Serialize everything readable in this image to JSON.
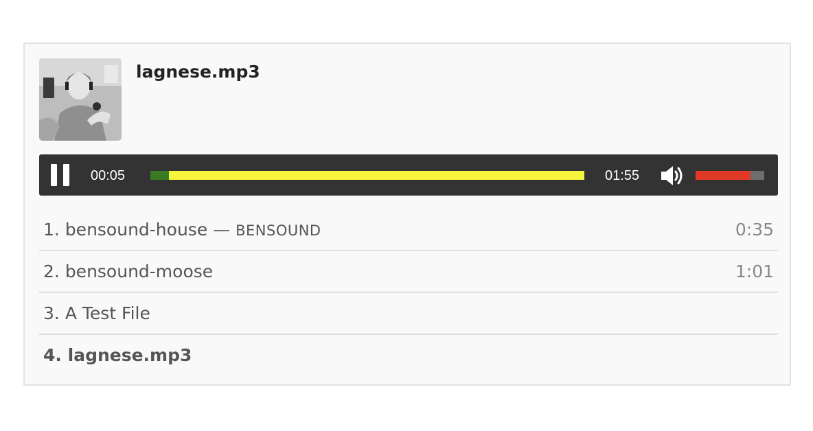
{
  "player": {
    "current_title": "lagnese.mp3",
    "current_time": "00:05",
    "duration": "01:55",
    "progress_fraction": 0.042,
    "volume_fraction": 0.8,
    "play_state": "playing",
    "cover_image": "album-cover-photo"
  },
  "playlist": [
    {
      "number": "1.",
      "title": "bensound-house",
      "separator": " — ",
      "artist": "BENSOUND",
      "length": "0:35",
      "active": false
    },
    {
      "number": "2.",
      "title": "bensound-moose",
      "separator": "",
      "artist": "",
      "length": "1:01",
      "active": false
    },
    {
      "number": "3.",
      "title": "A Test File",
      "separator": "",
      "artist": "",
      "length": "",
      "active": false
    },
    {
      "number": "4.",
      "title": "lagnese.mp3",
      "separator": "",
      "artist": "",
      "length": "",
      "active": true
    }
  ],
  "colors": {
    "controls_bg": "#333333",
    "progress_played": "#3a7a24",
    "progress_buffered": "#f6f43c",
    "volume_level": "#e03a26",
    "volume_track": "#6e6e6e"
  },
  "icons": [
    "pause-icon",
    "volume-icon"
  ]
}
